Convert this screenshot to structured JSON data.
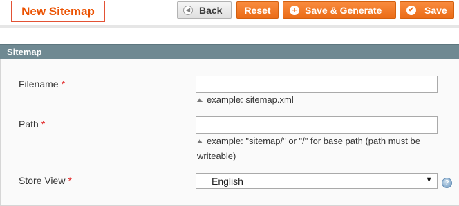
{
  "header": {
    "title": "New Sitemap",
    "buttons": {
      "back": "Back",
      "reset": "Reset",
      "save_generate": "Save & Generate",
      "save": "Save"
    }
  },
  "fieldset": {
    "legend": "Sitemap",
    "filename": {
      "label": "Filename",
      "required_mark": "*",
      "value": "",
      "note": "example: sitemap.xml"
    },
    "path": {
      "label": "Path",
      "required_mark": "*",
      "value": "",
      "note": "example: \"sitemap/\" or \"/\" for base path (path must be writeable)"
    },
    "store_view": {
      "label": "Store View",
      "required_mark": "*",
      "selected": "English",
      "help": "?"
    }
  },
  "colors": {
    "accent_orange": "#eb6c17",
    "title_orange": "#eb5202",
    "section_header": "#6f8992",
    "required_red": "#e22626"
  },
  "icons": {
    "back": "back-arrow-circle-icon",
    "save_generate": "plus-circle-icon",
    "save": "check-circle-icon",
    "note": "up-triangle-icon",
    "select": "chevron-down-icon",
    "help": "help-icon"
  }
}
